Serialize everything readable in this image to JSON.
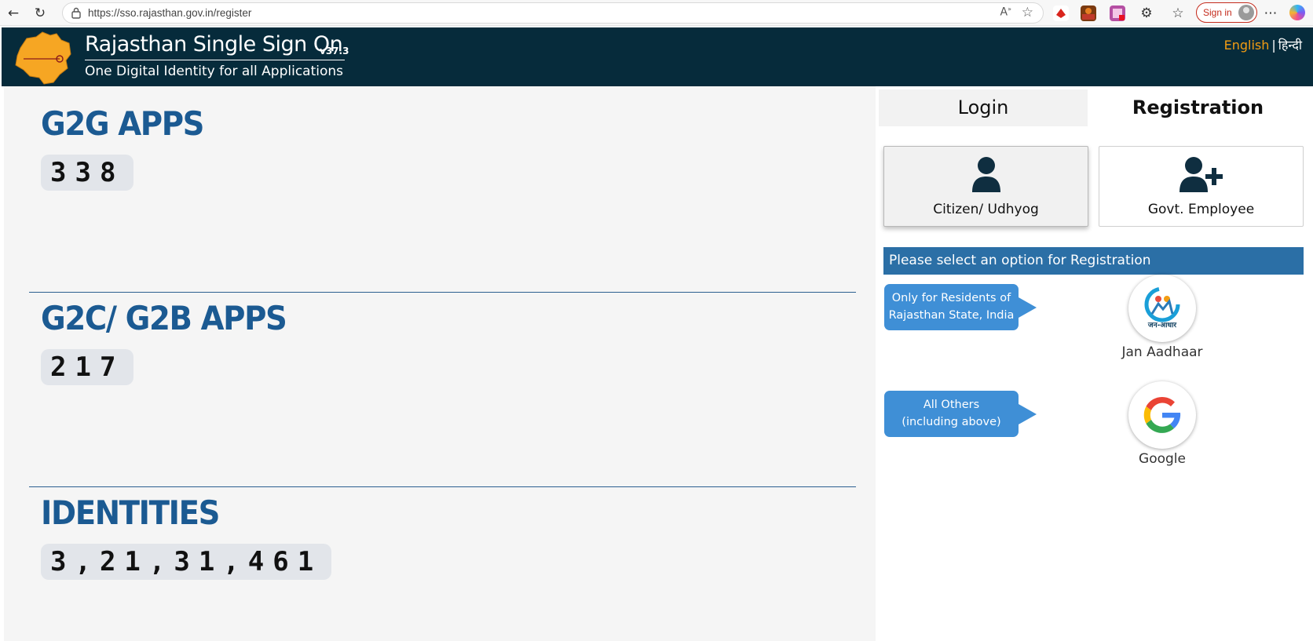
{
  "browser": {
    "url": "https://sso.rajasthan.gov.in/register",
    "signin_label": "Sign in",
    "icons": [
      "back-icon",
      "refresh-icon",
      "lock-icon",
      "read-aloud-icon",
      "favorite-star-icon",
      "extension-icon",
      "favorites-icon",
      "more-icon",
      "copilot-icon"
    ]
  },
  "header": {
    "logo_text": "Rajasthan",
    "logo_subtext": "Single Sign On",
    "title": "Rajasthan Single Sign On",
    "version": "v37.3",
    "subtitle": "One Digital Identity for all Applications",
    "lang_english": "English",
    "lang_separator": "|",
    "lang_hindi": "हिन्दी"
  },
  "stats": [
    {
      "title": "G2G APPS",
      "value": "338"
    },
    {
      "title": "G2C/ G2B APPS",
      "value": "217"
    },
    {
      "title": "IDENTITIES",
      "value": "3,21,31,461"
    }
  ],
  "tabs": {
    "login": "Login",
    "registration": "Registration"
  },
  "options": {
    "citizen": "Citizen/ Udhyog",
    "employee": "Govt. Employee"
  },
  "notice": "Please select an option for Registration",
  "providers": [
    {
      "bubble_line1": "Only for Residents of",
      "bubble_line2": "Rajasthan State, India",
      "label": "Jan Aadhaar",
      "logo_text": "जन-आधार"
    },
    {
      "bubble_line1": "All Others",
      "bubble_line2": "(including above)",
      "label": "Google"
    }
  ],
  "colors": {
    "header_bg": "#062b3b",
    "stat_title": "#1b5a92",
    "notice_bg": "#2b6fa6",
    "bubble_bg": "#3f8fd6",
    "lang_active": "#f39c12"
  }
}
